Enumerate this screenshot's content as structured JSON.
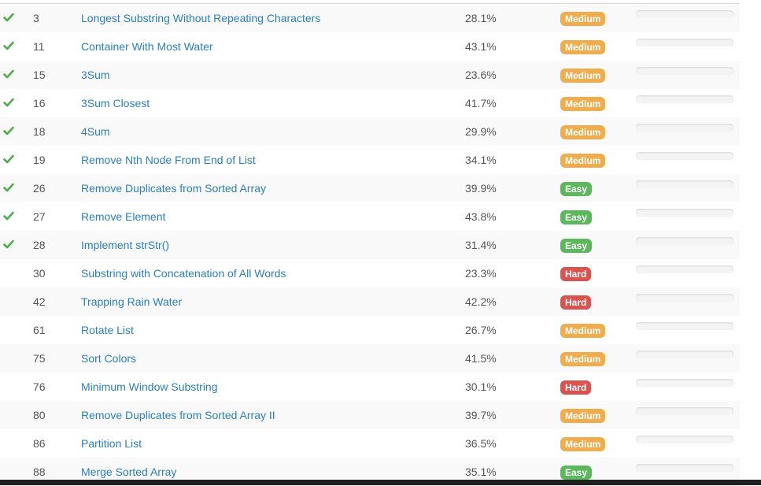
{
  "colors": {
    "medium": "#f0ad4e",
    "easy": "#5cb85c",
    "hard": "#d9534f",
    "check": "#4cae4c",
    "link": "#2a7fc0"
  },
  "problems": [
    {
      "id": "3",
      "title": "Longest Substring Without Repeating Characters",
      "acceptance": "28.1%",
      "difficulty": "Medium",
      "solved": true
    },
    {
      "id": "11",
      "title": "Container With Most Water",
      "acceptance": "43.1%",
      "difficulty": "Medium",
      "solved": true
    },
    {
      "id": "15",
      "title": "3Sum",
      "acceptance": "23.6%",
      "difficulty": "Medium",
      "solved": true
    },
    {
      "id": "16",
      "title": "3Sum Closest",
      "acceptance": "41.7%",
      "difficulty": "Medium",
      "solved": true
    },
    {
      "id": "18",
      "title": "4Sum",
      "acceptance": "29.9%",
      "difficulty": "Medium",
      "solved": true
    },
    {
      "id": "19",
      "title": "Remove Nth Node From End of List",
      "acceptance": "34.1%",
      "difficulty": "Medium",
      "solved": true
    },
    {
      "id": "26",
      "title": "Remove Duplicates from Sorted Array",
      "acceptance": "39.9%",
      "difficulty": "Easy",
      "solved": true
    },
    {
      "id": "27",
      "title": "Remove Element",
      "acceptance": "43.8%",
      "difficulty": "Easy",
      "solved": true
    },
    {
      "id": "28",
      "title": "Implement strStr()",
      "acceptance": "31.4%",
      "difficulty": "Easy",
      "solved": true
    },
    {
      "id": "30",
      "title": "Substring with Concatenation of All Words",
      "acceptance": "23.3%",
      "difficulty": "Hard",
      "solved": false
    },
    {
      "id": "42",
      "title": "Trapping Rain Water",
      "acceptance": "42.2%",
      "difficulty": "Hard",
      "solved": false
    },
    {
      "id": "61",
      "title": "Rotate List",
      "acceptance": "26.7%",
      "difficulty": "Medium",
      "solved": false
    },
    {
      "id": "75",
      "title": "Sort Colors",
      "acceptance": "41.5%",
      "difficulty": "Medium",
      "solved": false
    },
    {
      "id": "76",
      "title": "Minimum Window Substring",
      "acceptance": "30.1%",
      "difficulty": "Hard",
      "solved": false
    },
    {
      "id": "80",
      "title": "Remove Duplicates from Sorted Array II",
      "acceptance": "39.7%",
      "difficulty": "Medium",
      "solved": false
    },
    {
      "id": "86",
      "title": "Partition List",
      "acceptance": "36.5%",
      "difficulty": "Medium",
      "solved": false
    },
    {
      "id": "88",
      "title": "Merge Sorted Array",
      "acceptance": "35.1%",
      "difficulty": "Easy",
      "solved": false
    }
  ]
}
